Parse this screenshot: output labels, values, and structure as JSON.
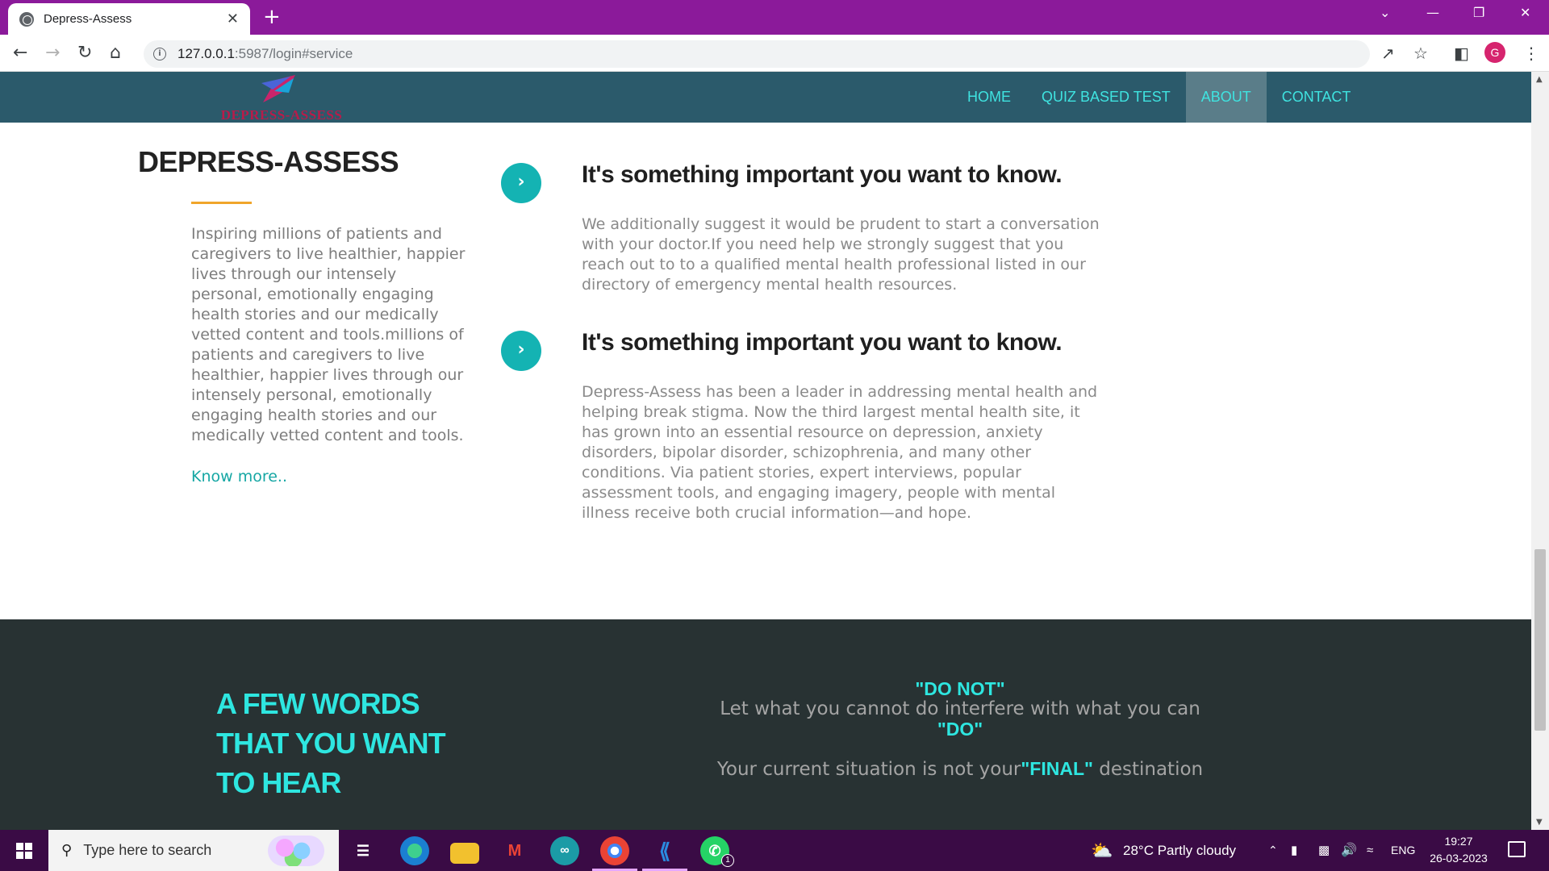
{
  "browser": {
    "tab_title": "Depress-Assess",
    "tab_close": "✕",
    "new_tab": "+",
    "url_host": "127.0.0.1",
    "url_rest": ":5987/login#service",
    "profile_initial": "G"
  },
  "site": {
    "logo_text": "DEPRESS-ASSESS",
    "menu": [
      {
        "label": "HOME"
      },
      {
        "label": "QUIZ BASED TEST"
      },
      {
        "label": "ABOUT",
        "active": true
      },
      {
        "label": "CONTACT"
      }
    ]
  },
  "about": {
    "title": "DEPRESS-ASSESS",
    "text": "Inspiring millions of patients and caregivers to live healthier, happier lives through our intensely personal, emotionally engaging health stories and our medically vetted content and tools.millions of patients and caregivers to live healthier, happier lives through our intensely personal, emotionally engaging health stories and our medically vetted content and tools.",
    "know_more": "Know more.."
  },
  "items": [
    {
      "title": "It's something important you want to know.",
      "text": "We additionally suggest it would be prudent to start a conversation with your doctor.If you need help we strongly suggest that you reach out to to a qualified mental health professional listed in our directory of emergency mental health resources."
    },
    {
      "title": "It's something important you want to know.",
      "text": "Depress-Assess has been a leader in addressing mental health and helping break stigma. Now the third largest mental health site, it has grown into an essential resource on depression, anxiety disorders, bipolar disorder, schizophrenia, and many other conditions. Via patient stories, expert interviews, popular assessment tools, and engaging imagery, people with mental illness receive both crucial information—and hope."
    }
  ],
  "quotes": {
    "heading": "A FEW WORDS THAT YOU WANT TO HEAR",
    "q1_hl1": "\"DO NOT\"",
    "q1_text": "Let what you cannot do interfere with what you can",
    "q1_hl2": "\"DO\"",
    "q2_pre": "Your current situation is not your",
    "q2_hl": "\"FINAL\"",
    "q2_post": " destination"
  },
  "taskbar": {
    "search_placeholder": "Type here to search",
    "weather": "28°C  Partly cloudy",
    "lang": "ENG",
    "time": "19:27",
    "date": "26-03-2023",
    "whatsapp_badge": "1"
  },
  "colors": {
    "tabbar": "#8b1a9a",
    "site_nav": "#2b5a6b",
    "accent": "#14b3b3",
    "quote_bg": "#283233"
  }
}
